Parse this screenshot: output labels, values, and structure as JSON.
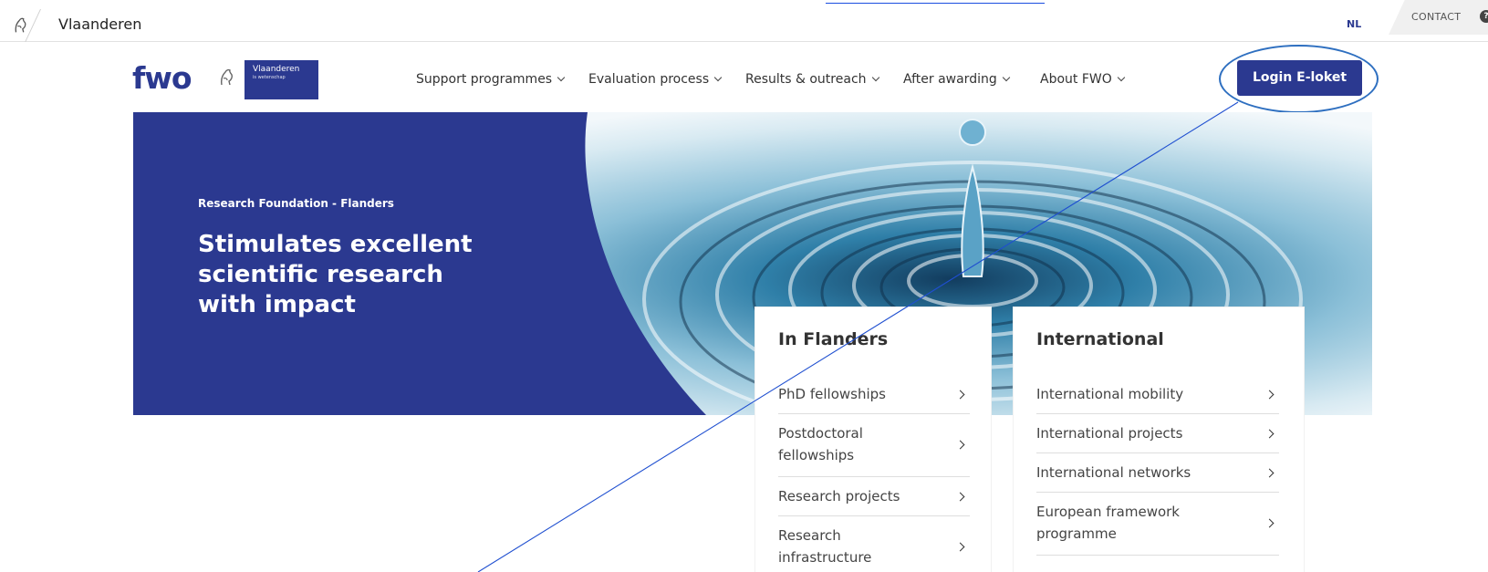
{
  "vlaanderen_bar": {
    "name": "Vlaanderen",
    "lang": "NL",
    "contact": "CONTACT"
  },
  "nav": {
    "logo": "fwo",
    "badge_title": "Vlaanderen",
    "badge_sub": "is wetenschap",
    "items": [
      {
        "label": "Support programmes"
      },
      {
        "label": "Evaluation process"
      },
      {
        "label": "Results & outreach"
      },
      {
        "label": "After awarding"
      },
      {
        "label": "About FWO"
      }
    ],
    "login": "Login E-loket"
  },
  "hero": {
    "kicker": "Research Foundation - Flanders",
    "title": "Stimulates excellent scientific research with impact"
  },
  "cards": [
    {
      "title": "In Flanders",
      "items": [
        {
          "label": "PhD fellowships"
        },
        {
          "label": "Postdoctoral fellowships"
        },
        {
          "label": "Research projects"
        },
        {
          "label": "Research infrastructure"
        }
      ]
    },
    {
      "title": "International",
      "items": [
        {
          "label": "International mobility"
        },
        {
          "label": "International projects"
        },
        {
          "label": "International networks"
        },
        {
          "label": "European framework programme"
        }
      ]
    }
  ],
  "colors": {
    "brand_blue": "#2b3990",
    "annotation_blue": "#2e6fc0"
  },
  "icons": {
    "lion": "flemish-lion-icon",
    "chevron": "chevron-right-icon",
    "help": "help-circle-icon"
  }
}
